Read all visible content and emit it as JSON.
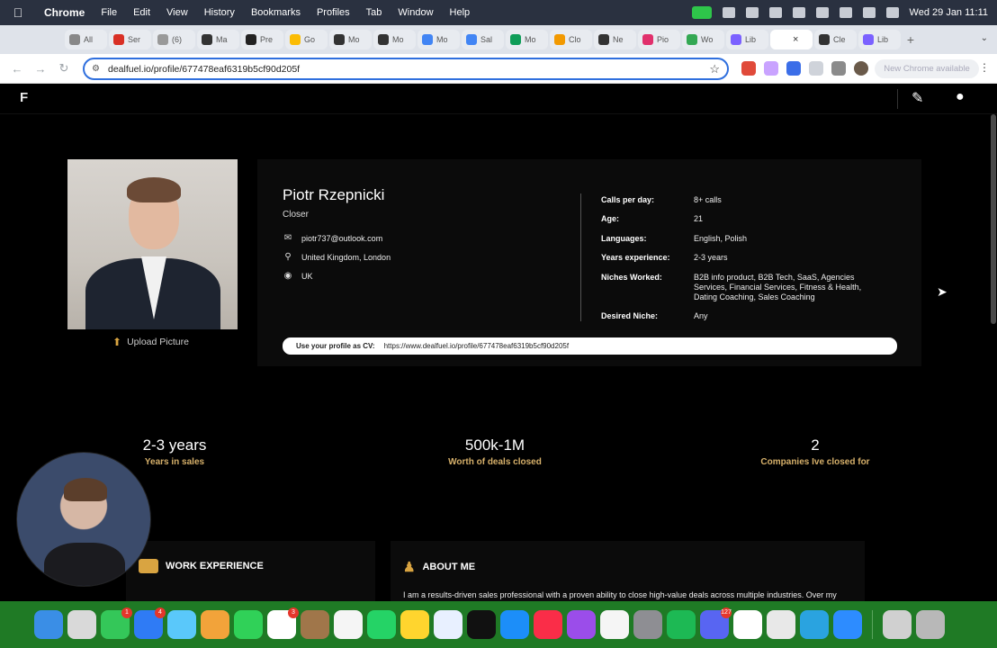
{
  "menubar": {
    "app": "Chrome",
    "items": [
      "File",
      "Edit",
      "View",
      "History",
      "Bookmarks",
      "Profiles",
      "Tab",
      "Window",
      "Help"
    ],
    "clock": "Wed 29 Jan  11:11"
  },
  "tabs": [
    {
      "label": "All",
      "color": "#888888"
    },
    {
      "label": "Ser",
      "color": "#d93025"
    },
    {
      "label": "(6)",
      "color": "#999999"
    },
    {
      "label": "Ma",
      "color": "#333333"
    },
    {
      "label": "Pre",
      "color": "#222222"
    },
    {
      "label": "Go",
      "color": "#fbbc04"
    },
    {
      "label": "Mo",
      "color": "#333333"
    },
    {
      "label": "Mo",
      "color": "#333333"
    },
    {
      "label": "Mo",
      "color": "#4285f4"
    },
    {
      "label": "Sal",
      "color": "#4285f4"
    },
    {
      "label": "Mo",
      "color": "#0f9d58"
    },
    {
      "label": "Clo",
      "color": "#f29900"
    },
    {
      "label": "Ne",
      "color": "#333333"
    },
    {
      "label": "Pio",
      "color": "#e1306c"
    },
    {
      "label": "Wo",
      "color": "#34a853"
    },
    {
      "label": "Lib",
      "color": "#7b61ff"
    },
    {
      "label": "",
      "color": "#ffffff"
    },
    {
      "label": "Cle",
      "color": "#333333"
    },
    {
      "label": "Lib",
      "color": "#7b61ff"
    }
  ],
  "tab_close": "×",
  "new_tab": "+",
  "address": {
    "url": "dealfuel.io/profile/677478eaf6319b5cf90d205f",
    "update_label": "New Chrome available"
  },
  "site": {
    "logo": "F"
  },
  "profile": {
    "name": "Piotr Rzepnicki",
    "role": "Closer",
    "email": "piotr737@outlook.com",
    "location": "United Kingdom, London",
    "country": "UK",
    "upload_label": "Upload Picture",
    "details": [
      {
        "key": "Calls per day:",
        "value": "8+ calls"
      },
      {
        "key": "Age:",
        "value": "21"
      },
      {
        "key": "Languages:",
        "value": "English, Polish"
      },
      {
        "key": "Years experience:",
        "value": "2-3 years"
      },
      {
        "key": "Niches Worked:",
        "value": "B2B info product, B2B Tech, SaaS, Agencies Services, Financial Services, Fitness & Health, Dating Coaching, Sales Coaching"
      },
      {
        "key": "Desired Niche:",
        "value": "Any"
      }
    ],
    "cv_label": "Use your profile as CV:",
    "cv_url": "https://www.dealfuel.io/profile/677478eaf6319b5cf90d205f"
  },
  "stats": [
    {
      "number": "2-3 years",
      "label": "Years in sales"
    },
    {
      "number": "500k-1M",
      "label": "Worth of deals closed"
    },
    {
      "number": "2",
      "label": "Companies Ive closed for"
    }
  ],
  "panels": {
    "work_title": "WORK EXPERIENCE",
    "about_title": "ABOUT ME",
    "about_text": "I am a results-driven sales professional with a proven ability to close high-value deals across multiple industries. Over my career, I've demonstrated adaptability and a commitment to acting with speed and precision, ensuring"
  },
  "dock": {
    "icons": [
      {
        "name": "finder",
        "color": "#3a8ee6"
      },
      {
        "name": "launchpad",
        "color": "#d9d9d9"
      },
      {
        "name": "messages",
        "color": "#34c759",
        "badge": "1"
      },
      {
        "name": "mail",
        "color": "#2f7bf5",
        "badge": "4"
      },
      {
        "name": "maps",
        "color": "#5ac8fa"
      },
      {
        "name": "photos",
        "color": "#f2a33a"
      },
      {
        "name": "facetime",
        "color": "#30d158"
      },
      {
        "name": "calendar",
        "color": "#ffffff",
        "badge": "3"
      },
      {
        "name": "notes-brown",
        "color": "#a0764a"
      },
      {
        "name": "reminders",
        "color": "#f5f5f5"
      },
      {
        "name": "whatsapp",
        "color": "#25d366"
      },
      {
        "name": "notes",
        "color": "#ffd52e"
      },
      {
        "name": "freeform",
        "color": "#e8f0ff"
      },
      {
        "name": "apple-tv",
        "color": "#111111"
      },
      {
        "name": "app-store",
        "color": "#1c8ef9"
      },
      {
        "name": "music",
        "color": "#fa2d48"
      },
      {
        "name": "podcasts",
        "color": "#9b4dea"
      },
      {
        "name": "news",
        "color": "#f5f5f5"
      },
      {
        "name": "system-settings",
        "color": "#8e8e93"
      },
      {
        "name": "spotify",
        "color": "#1db954"
      },
      {
        "name": "discord",
        "color": "#5865f2",
        "badge": "127"
      },
      {
        "name": "notion",
        "color": "#ffffff"
      },
      {
        "name": "chrome",
        "color": "#e8e8e8"
      },
      {
        "name": "telegram",
        "color": "#2aa3e0"
      },
      {
        "name": "zoom",
        "color": "#2d8cff"
      }
    ],
    "right_icons": [
      {
        "name": "downloads",
        "color": "#d0d0d0"
      },
      {
        "name": "trash",
        "color": "#b8b8b8"
      }
    ]
  }
}
